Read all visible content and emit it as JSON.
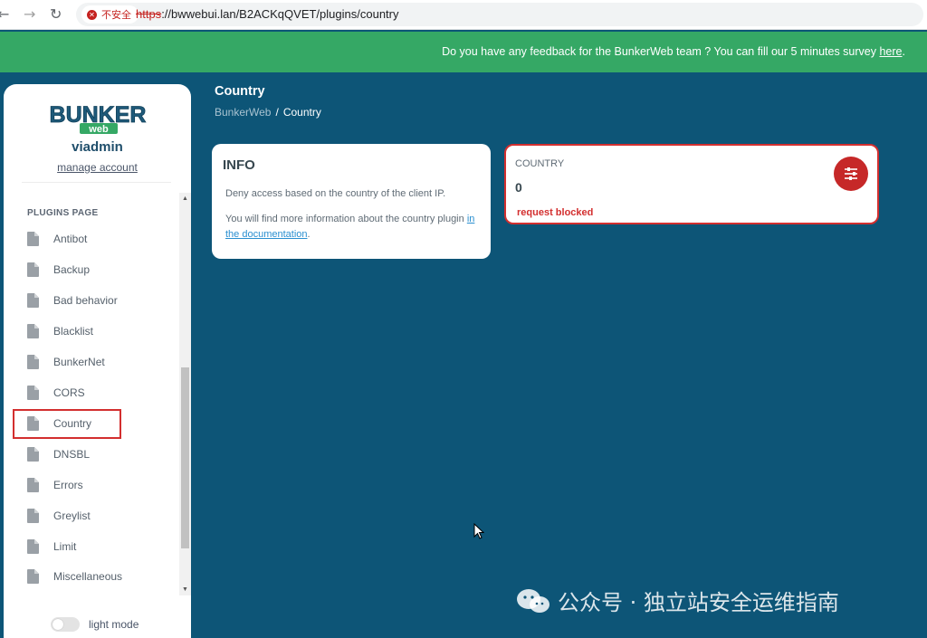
{
  "browser": {
    "insecure_label": "不安全",
    "url_scheme": "https",
    "url_rest": "://bwwebui.lan/B2ACKqQVET/plugins/country"
  },
  "banner": {
    "text": "Do you have any feedback for the BunkerWeb team ? You can fill our 5 minutes survey ",
    "link": "here",
    "end": "."
  },
  "sidebar": {
    "logo_text": "BUNKER",
    "logo_sub": "web",
    "username": "viadmin",
    "manage_account": "manage account",
    "section_title": "PLUGINS PAGE",
    "items": [
      {
        "label": "Antibot"
      },
      {
        "label": "Backup"
      },
      {
        "label": "Bad behavior"
      },
      {
        "label": "Blacklist"
      },
      {
        "label": "BunkerNet"
      },
      {
        "label": "CORS"
      },
      {
        "label": "Country"
      },
      {
        "label": "DNSBL"
      },
      {
        "label": "Errors"
      },
      {
        "label": "Greylist"
      },
      {
        "label": "Limit"
      },
      {
        "label": "Miscellaneous"
      }
    ],
    "active_item": "Country",
    "mode_toggle_label": "light mode",
    "mode_toggle_on": false
  },
  "header": {
    "title": "Country",
    "breadcrumb_root": "BunkerWeb",
    "breadcrumb_sep": "/",
    "breadcrumb_current": "Country"
  },
  "info_card": {
    "title": "INFO",
    "description": "Deny access based on the country of the client IP.",
    "more_text": "You will find more information about the country plugin ",
    "more_link": "in the documentation",
    "more_end": "."
  },
  "stat_card": {
    "label": "COUNTRY",
    "value": "0",
    "note": "request blocked",
    "icon": "sliders-icon"
  },
  "watermark": {
    "text": "公众号 · 独立站安全运维指南",
    "icon": "wechat-icon"
  },
  "colors": {
    "background": "#0d5577",
    "banner": "#35a865",
    "accent_red": "#c62828",
    "link": "#2a8fd0"
  }
}
